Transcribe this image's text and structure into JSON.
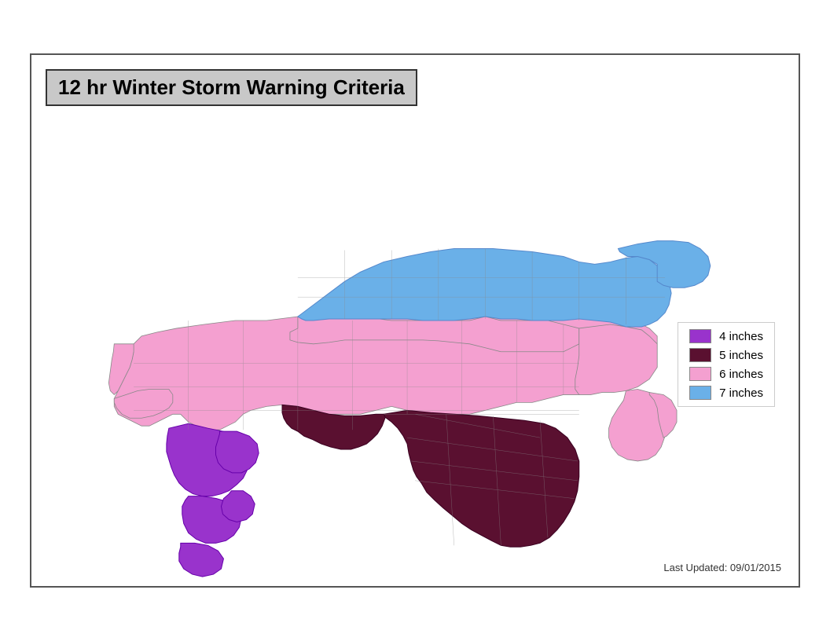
{
  "title": "12 hr Winter Storm Warning Criteria",
  "legend": {
    "items": [
      {
        "label": "4 inches",
        "color": "#9933cc"
      },
      {
        "label": "5 inches",
        "color": "#5a0020"
      },
      {
        "label": "6 inches",
        "color": "#f4a0d0"
      },
      {
        "label": "7 inches",
        "color": "#6ab0e8"
      }
    ]
  },
  "last_updated_label": "Last Updated:  09/01/2015",
  "colors": {
    "purple": "#9933cc",
    "dark_maroon": "#5a1030",
    "pink": "#f4a0d0",
    "blue": "#6ab0e8",
    "frame_border": "#555555"
  }
}
